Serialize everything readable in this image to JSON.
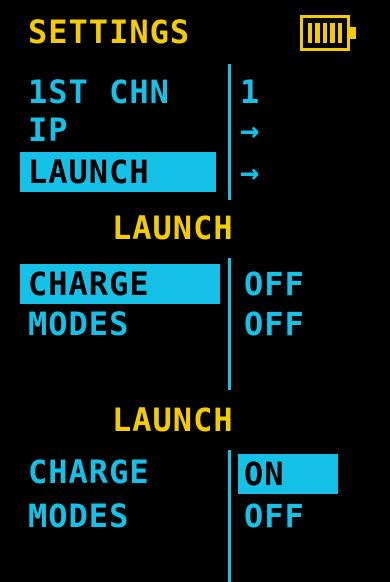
{
  "header": {
    "title": "SETTINGS",
    "battery_icon": "battery-full-icon"
  },
  "settings_menu": [
    {
      "label": "1ST CHN",
      "value": "1",
      "selected": false
    },
    {
      "label": "IP",
      "value": "→",
      "selected": false
    },
    {
      "label": "LAUNCH",
      "value": "→",
      "selected": true
    }
  ],
  "launch_panel_1": {
    "title": "LAUNCH",
    "rows": [
      {
        "label": "CHARGE",
        "value": "OFF",
        "label_selected": true,
        "value_selected": false
      },
      {
        "label": "MODES",
        "value": "OFF",
        "label_selected": false,
        "value_selected": false
      }
    ]
  },
  "launch_panel_2": {
    "title": "LAUNCH",
    "rows": [
      {
        "label": "CHARGE",
        "value": "ON",
        "label_selected": false,
        "value_selected": true
      },
      {
        "label": "MODES",
        "value": "OFF",
        "label_selected": false,
        "value_selected": false
      }
    ]
  },
  "colors": {
    "accent": "#16c1e8",
    "title": "#f2cc00",
    "background": "#000000"
  }
}
